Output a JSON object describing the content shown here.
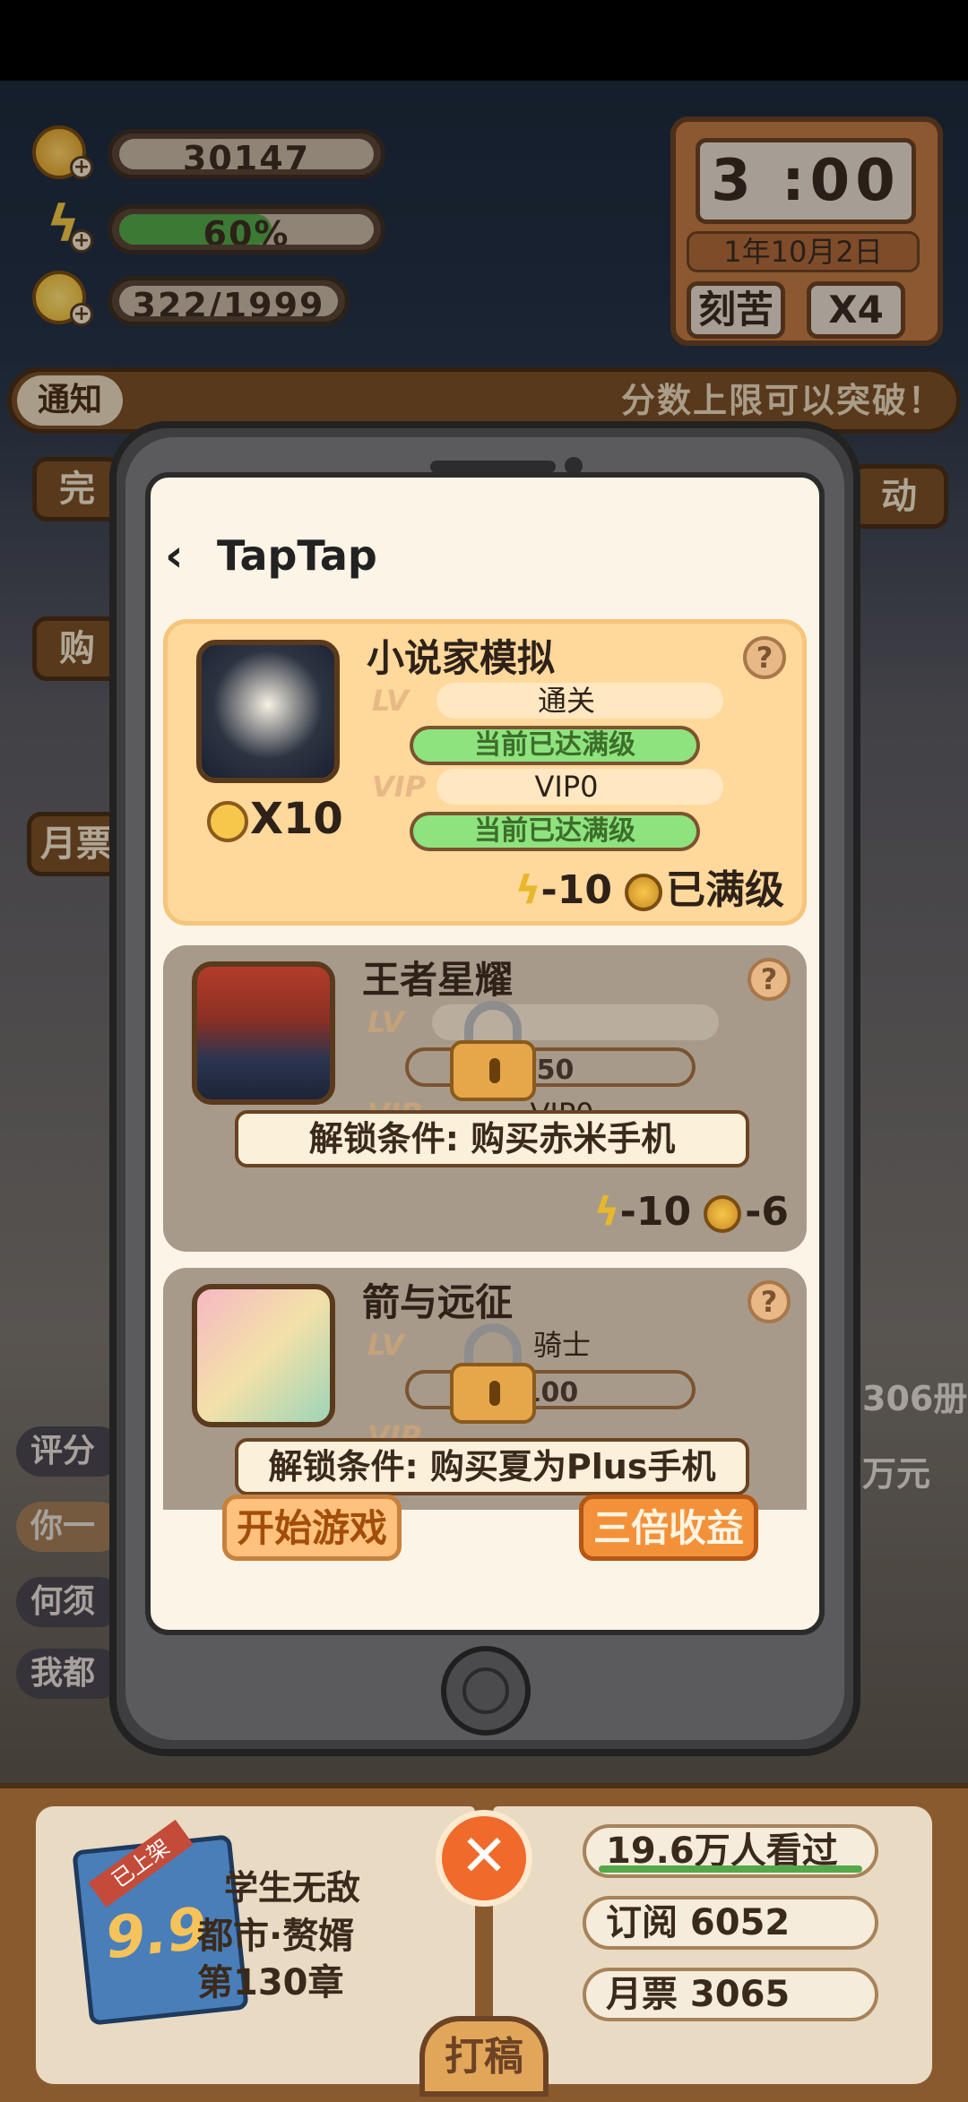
{
  "hud": {
    "coins": "30147",
    "energy_percent_label": "60%",
    "energy_level": 0.6,
    "ideas": "322/1999",
    "clock_time": "3 :00",
    "date": "1年10月2日",
    "mode_button": "刻苦",
    "speed_button": "X4"
  },
  "notice": {
    "label": "通知",
    "text": "分数上限可以突破！"
  },
  "side_left": {
    "complete_label": "完",
    "shop_label": "购",
    "monthly_label": "月票",
    "pill1": "评分",
    "pill2": "你一",
    "pill3": "何须",
    "pill4": "我都"
  },
  "side_right": {
    "activity_label": "动",
    "books_count": "306册",
    "money": "万元"
  },
  "phone": {
    "app_title": "TapTap",
    "back_icon": "chevron-left-icon",
    "games": [
      {
        "name": "小说家模拟",
        "lv_tag": "LV",
        "lv_value": "通关",
        "lv_bar": "当前已达满级",
        "vip_tag": "VIP",
        "vip_value": "VIP0",
        "vip_bar": "当前已达满级",
        "reward": "X10",
        "energy_cost": "-10",
        "coin_cost": "已满级",
        "locked": false
      },
      {
        "name": "王者星耀",
        "lv_tag": "LV",
        "lv_bar": "/50",
        "vip_tag": "VIP",
        "vip_value": "VIP0",
        "unlock_condition": "解锁条件: 购买赤米手机",
        "energy_cost": "-10",
        "coin_cost": "-6",
        "locked": true
      },
      {
        "name": "箭与远征",
        "lv_tag": "LV",
        "lv_value": "骑士",
        "lv_bar": "100",
        "vip_tag": "VIP",
        "unlock_condition": "解锁条件: 购买夏为Plus手机",
        "locked": true
      }
    ],
    "start_button": "开始游戏",
    "triple_button": "三倍收益"
  },
  "book": {
    "ribbon": "已上架",
    "score": "9.9",
    "title": "学生无敌",
    "genre": "都市·赘婿",
    "chapter": "第130章",
    "views": "19.6万人看过",
    "subscriptions": "订阅 6052",
    "monthly_votes": "月票 3065",
    "draft_button": "打稿",
    "close_icon": "close-icon"
  },
  "colors": {
    "accent_orange": "#f3913a",
    "level_green": "#8ee37e",
    "card_active": "#ffd89c"
  }
}
